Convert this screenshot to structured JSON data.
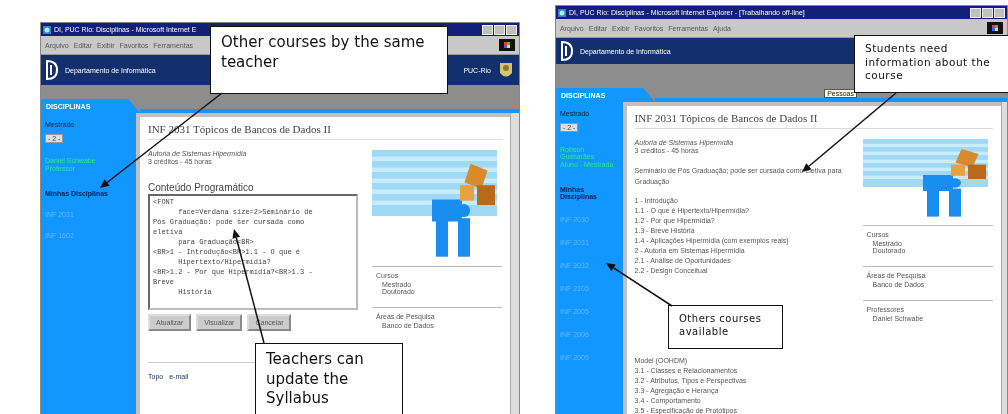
{
  "screenshots": [
    {
      "window_title": "DI, PUC Rio: Disciplinas - Microsoft Internet E",
      "menu": [
        "Arquivo",
        "Editar",
        "Exibir",
        "Favoritos",
        "Ferramentas"
      ],
      "header_title": "Departamento de Informática",
      "header_right": "PUC-Rio",
      "section": "DISCIPLINAS",
      "sidebar": [
        {
          "kind": "label",
          "text": "Mestrado"
        },
        {
          "kind": "select",
          "text": "- 2 -"
        },
        {
          "kind": "name",
          "text": "Daniel Schwabe"
        },
        {
          "kind": "role",
          "text": "Professor"
        },
        {
          "kind": "heading",
          "text": "Minhas Disciplinas"
        },
        {
          "kind": "link",
          "text": "INF 2031"
        },
        {
          "kind": "link",
          "text": "INF 1602"
        }
      ],
      "course_title": "INF 2031 Tópicos de Bancos de Dados II",
      "subtitle": "Autoria de Sistemas Hipermídia",
      "credits": "3 créditos - 45 horas",
      "content_heading": "Conteúdo Programático",
      "editor_text": "<FONT\n      face=Verdana size=2>Seminário de\nPós Graduação: pode ser cursada como\neletiva\n      para Graduação<BR>\n<BR>1 - Introdução<BR>1.1 - O que é\n      Hipertexto/Hipermídia?\n<BR>1.2 - Por que Hipermídia?<BR>1.3 -\nBreve\n      História",
      "buttons": [
        "Atualizar",
        "Visualizar",
        "Cancelar"
      ],
      "footer_links": [
        "Topo",
        "e-mail"
      ],
      "info_boxes": [
        {
          "heading": "Cursos",
          "items": [
            "Mestrado",
            "Doutorado"
          ]
        },
        {
          "heading": "Áreas de Pesquisa",
          "items": [
            "Banco de Dados"
          ]
        }
      ]
    },
    {
      "window_title": "DI, PUC Rio: Disciplinas - Microsoft Internet Explorer - [Trabalhando off-line]",
      "menu": [
        "Arquivo",
        "Editar",
        "Exibir",
        "Favoritos",
        "Ferramentas",
        "Ajuda"
      ],
      "header_title": "Departamento de Informática",
      "toolbar_tooltip": "Pessoas",
      "section": "DISCIPLINAS",
      "sidebar": [
        {
          "kind": "label",
          "text": "Mestrado"
        },
        {
          "kind": "select",
          "text": "- 2 -"
        },
        {
          "kind": "name",
          "text": "Robson Guimarães"
        },
        {
          "kind": "role",
          "text": "Aluno - Mestrado"
        },
        {
          "kind": "heading",
          "text": "Minhas Disciplinas"
        },
        {
          "kind": "link",
          "text": "INF 2030"
        },
        {
          "kind": "link",
          "text": "INF 2031"
        },
        {
          "kind": "link",
          "text": "INF 2032"
        },
        {
          "kind": "link",
          "text": "INF 2105"
        },
        {
          "kind": "link",
          "text": "INF 2005"
        },
        {
          "kind": "link",
          "text": "INF 2006"
        },
        {
          "kind": "link",
          "text": "INF 2009"
        }
      ],
      "course_title": "INF 2031 Tópicos de Bancos de Dados II",
      "subtitle": "Autoria de Sistemas Hipermídia",
      "credits": "3 créditos - 45 horas",
      "description": "Seminário de Pós Graduação; pode ser cursada como eletiva para Graduação",
      "syllabus_top": [
        "1 - Introdução",
        "1.1 - O que é Hipertexto/Hipermídia?",
        "1.2 - Por que Hipermídia?",
        "1.3 - Breve História",
        "1.4 - Aplicações Hipermídia (com exemplos reais)",
        "2 - Autoria em Sistemas Hipermídia",
        "2.1 - Análise de Oportunidades",
        "2.2 - Design Conceitual"
      ],
      "syllabus_bottom": [
        "Model (OOHDM)",
        "3.1 - Classes e Relacionamentos",
        "3.2 - Atributos, Tipos e Perspectivas",
        "3.3 - Agregação e Herança",
        "3.4 - Comportamento",
        "3.5 - Especificação de Protótipos"
      ],
      "info_boxes": [
        {
          "heading": "Cursos",
          "items": [
            "Mestrado",
            "Doutorado"
          ]
        },
        {
          "heading": "Áreas de Pesquisa",
          "items": [
            "Banco de Dados"
          ]
        },
        {
          "heading": "Professores",
          "items": [
            "Daniel Schwabe"
          ]
        }
      ]
    }
  ],
  "callouts": [
    {
      "text": "Other courses by the same teacher"
    },
    {
      "text": "Teachers can update the Syllabus"
    },
    {
      "text": "Students need information about the course"
    },
    {
      "text": "Others courses available"
    }
  ]
}
